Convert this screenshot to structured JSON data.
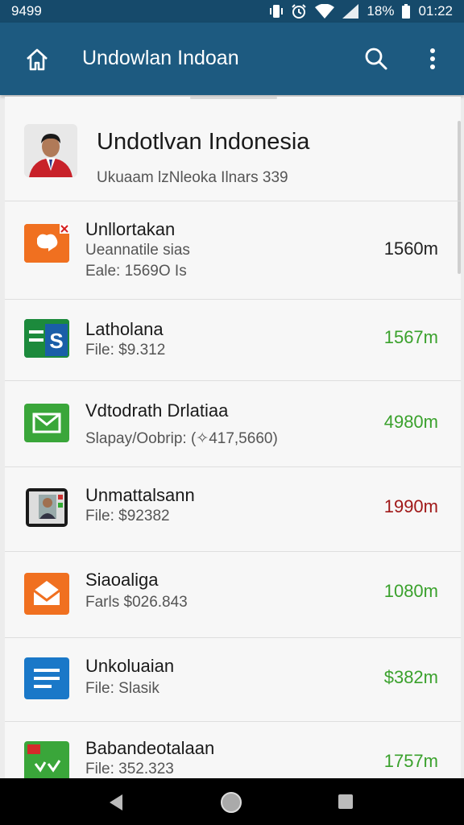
{
  "status_bar": {
    "left_text": "9499",
    "battery": "18%",
    "time": "01:22"
  },
  "app_bar": {
    "title": "Undowlan Indoan",
    "icons": [
      "home-icon",
      "search-icon",
      "more-vert-icon"
    ]
  },
  "profile": {
    "name": "Undotlvan Indonesia",
    "subtitle": "Ukuaam lzNleoka Ilnars 339"
  },
  "items": [
    {
      "title": "Unllortakan",
      "line1": "Ueannatile sias",
      "line2": "Eale: 1569O Is",
      "amount": "1560m",
      "amount_color": "#222222",
      "icon": "orange-chat-icon"
    },
    {
      "title": "Latholana",
      "line1": "File: $9.312",
      "amount": "1567m",
      "amount_color": "#3aa12c",
      "icon": "sheets-icon"
    },
    {
      "title": "Vdtodrath Drlatiaa",
      "line1": "Slapay/Oobrip: (✧417,5660)",
      "amount": "4980m",
      "amount_color": "#3aa12c",
      "icon": "green-mail-icon"
    },
    {
      "title": "Unmattalsann",
      "line1": "File: $92382",
      "amount": "1990m",
      "amount_color": "#a01818",
      "icon": "tablet-photo-icon"
    },
    {
      "title": "Siaoaliga",
      "line1": "Farls $026.843",
      "amount": "1080m",
      "amount_color": "#3aa12c",
      "icon": "orange-envelope-icon"
    },
    {
      "title": "Unkoluaian",
      "line1": "File: Slasik",
      "amount": "$382m",
      "amount_color": "#3aa12c",
      "icon": "blue-doc-icon"
    },
    {
      "title": "Babandeotalaan",
      "line1": "File: 352.323",
      "amount": "1757m",
      "amount_color": "#3aa12c",
      "icon": "green-check-icon"
    }
  ],
  "nav": {
    "icons": [
      "back-icon",
      "home-circle-icon",
      "recents-icon"
    ]
  }
}
